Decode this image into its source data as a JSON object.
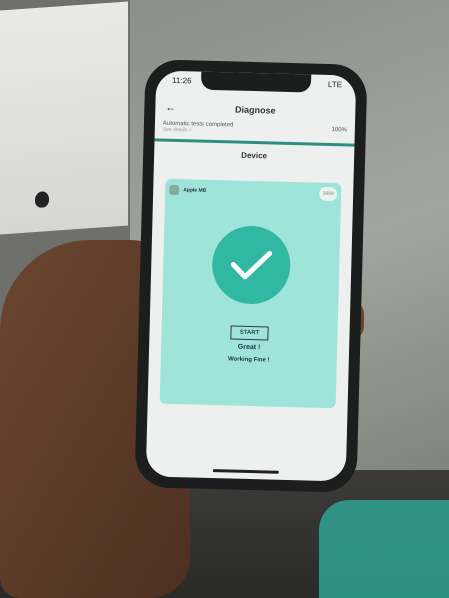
{
  "status": {
    "time": "11:26",
    "network": "LTE"
  },
  "header": {
    "back_icon": "arrow-left-icon",
    "title": "Diagnose"
  },
  "tests": {
    "label": "Automatic tests completed",
    "sublabel": "See details >",
    "percent": "100%",
    "progress": 1.0
  },
  "section_title": "Device",
  "card": {
    "name": "Apple MB",
    "badge": "3999",
    "button": "START",
    "result": "Great !",
    "detail": "Working Fine !"
  },
  "colors": {
    "accent": "#30b8a3",
    "card": "#9fe4d8"
  }
}
